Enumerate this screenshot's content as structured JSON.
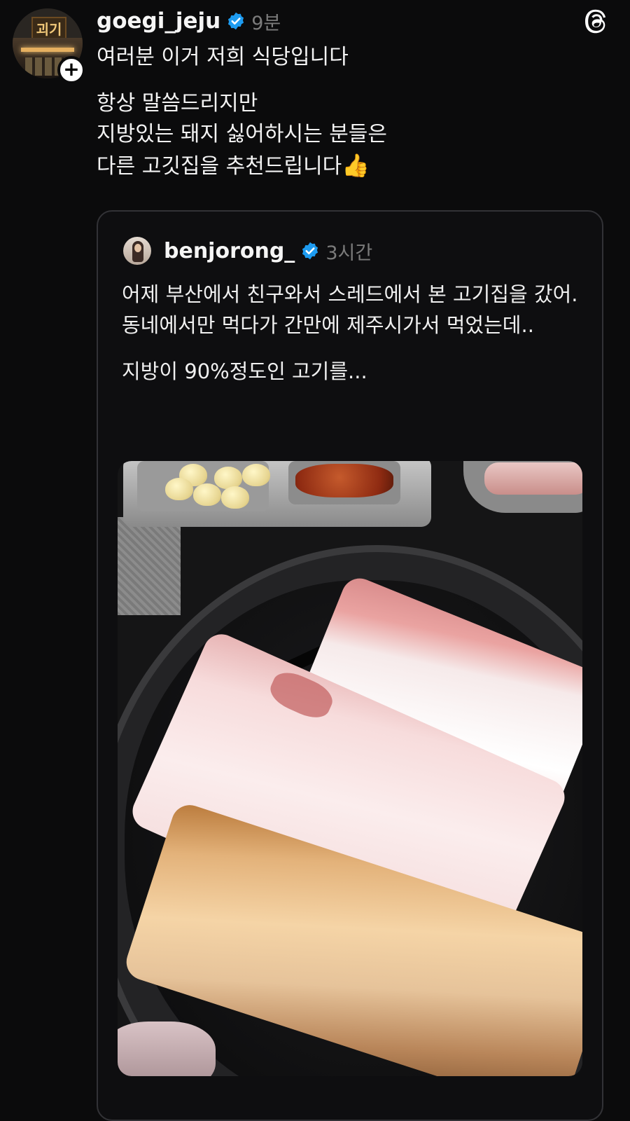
{
  "post": {
    "username": "goegi_jeju",
    "time": "9분",
    "avatar_sign": "괴기",
    "follow_symbol": "+",
    "lines": [
      "여러분 이거 저희 식당입니다",
      "항상 말씀드리지만",
      "지방있는 돼지 싫어하시는 분들은",
      "다른 고깃집을 추천드립니다"
    ],
    "emoji": "👍"
  },
  "quote": {
    "username": "benjorong_",
    "time": "3시간",
    "lines": [
      "어제 부산에서 친구와서 스레드에서 본 고기집을 갔어.",
      "동네에서만 먹다가 간만에 제주시가서 먹었는데..",
      "지방이 90%정도인 고기를..."
    ]
  },
  "icons": {
    "verified": "verified-badge-icon",
    "app": "threads-logo-icon",
    "follow": "plus-icon"
  },
  "colors": {
    "background": "#0b0b0c",
    "verified": "#1d9bf0",
    "muted_text": "#7b7b7b",
    "card_border": "#323236"
  }
}
